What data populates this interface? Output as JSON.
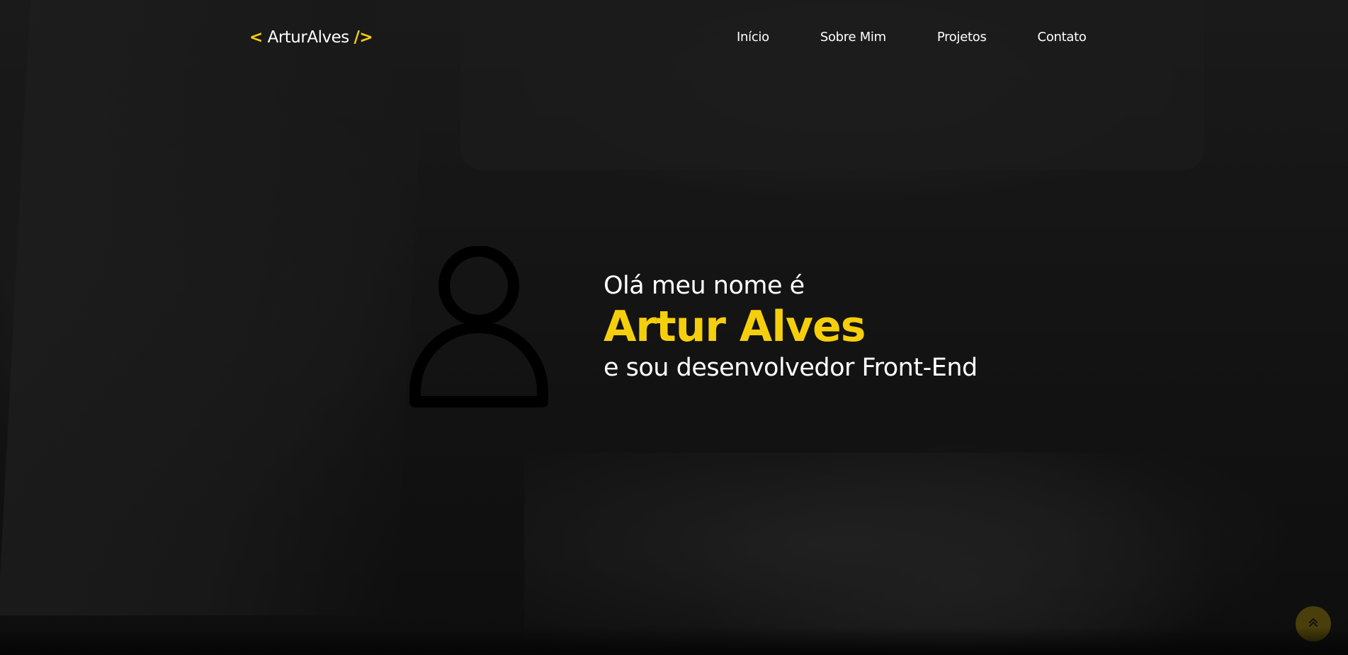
{
  "header": {
    "logo": {
      "open_bracket": "<",
      "text": "ArturAlves",
      "close_bracket": "/>"
    },
    "nav": [
      {
        "label": "Início"
      },
      {
        "label": "Sobre Mim"
      },
      {
        "label": "Projetos"
      },
      {
        "label": "Contato"
      }
    ]
  },
  "hero": {
    "greeting": "Olá meu nome é",
    "name": "Artur Alves",
    "role": "e sou desenvolvedor Front-End",
    "avatar_icon": "user-icon"
  },
  "scroll_top": {
    "icon": "chevrons-up-icon"
  },
  "colors": {
    "accent": "#f5cf0c",
    "text": "#ffffff",
    "background": "#141414",
    "scroll_button": "#4a3f0a"
  }
}
